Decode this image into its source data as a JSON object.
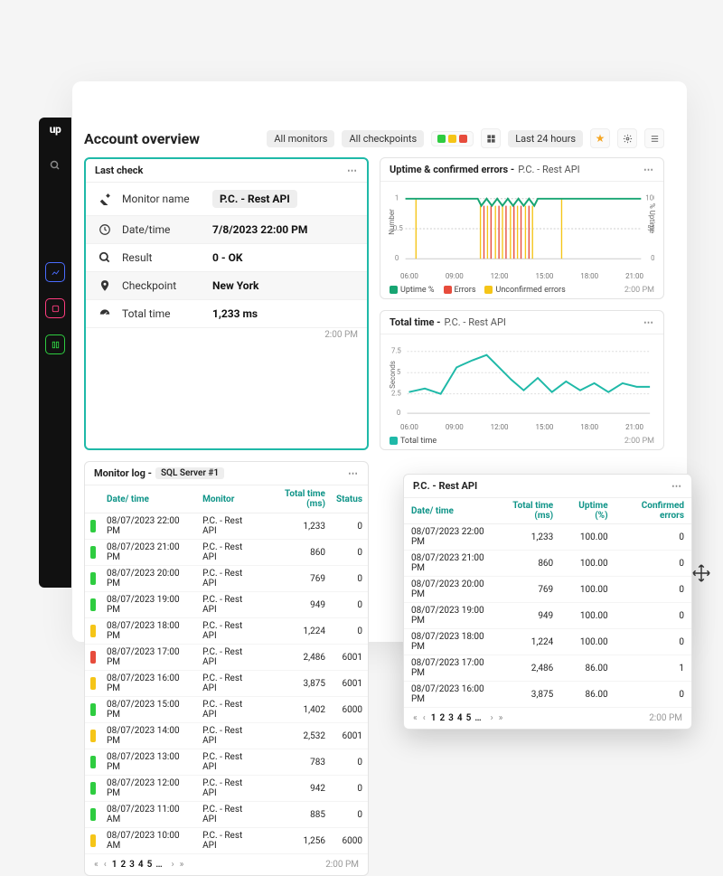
{
  "header": {
    "title": "Account overview",
    "filter_monitors": "All monitors",
    "filter_checkpoints": "All checkpoints",
    "timerange": "Last 24 hours"
  },
  "sidebar": {
    "logo": "up"
  },
  "last_check": {
    "title": "Last check",
    "rows": [
      {
        "label": "Monitor name",
        "value": "P.C. - Rest API",
        "chip": true
      },
      {
        "label": "Date/time",
        "value": "7/8/2023 22:00 PM"
      },
      {
        "label": "Result",
        "value": "0 - OK"
      },
      {
        "label": "Checkpoint",
        "value": "New York"
      },
      {
        "label": "Total time",
        "value": "1,233 ms"
      }
    ],
    "timestamp": "2:00 PM"
  },
  "uptime_card": {
    "title": "Uptime & confirmed errors -",
    "subtitle": "P.C. - Rest API",
    "left_axis": "Number",
    "right_axis": "% Uptime",
    "legend": {
      "uptime": "Uptime %",
      "errors": "Errors",
      "unconfirmed": "Unconfirmed errors"
    },
    "timestamp": "2:00 PM",
    "xticks": [
      "06:00",
      "09:00",
      "12:00",
      "15:00",
      "18:00",
      "21:00"
    ],
    "yticks_left": [
      "1",
      "0.5",
      "0"
    ],
    "yticks_right": [
      "100",
      "50",
      "0"
    ]
  },
  "totaltime_card": {
    "title": "Total time -",
    "subtitle": "P.C. - Rest API",
    "left_axis": "Seconds",
    "legend": {
      "total": "Total time"
    },
    "timestamp": "2:00 PM",
    "xticks": [
      "06:00",
      "09:00",
      "12:00",
      "15:00",
      "18:00",
      "21:00"
    ],
    "yticks": [
      "7.5",
      "5",
      "2.5",
      "0"
    ]
  },
  "monitor_log": {
    "title": "Monitor log -",
    "chip": "SQL Server #1",
    "columns": {
      "dt": "Date/ time",
      "mon": "Monitor",
      "tt": "Total time (ms)",
      "st": "Status"
    },
    "rows": [
      {
        "s": "ok",
        "dt": "08/07/2023 22:00 PM",
        "mon": "P.C. - Rest API",
        "tt": "1,233",
        "st": "0"
      },
      {
        "s": "ok",
        "dt": "08/07/2023 21:00 PM",
        "mon": "P.C. - Rest API",
        "tt": "860",
        "st": "0"
      },
      {
        "s": "ok",
        "dt": "08/07/2023 20:00 PM",
        "mon": "P.C. - Rest API",
        "tt": "769",
        "st": "0"
      },
      {
        "s": "ok",
        "dt": "08/07/2023 19:00 PM",
        "mon": "P.C. - Rest API",
        "tt": "949",
        "st": "0"
      },
      {
        "s": "warn",
        "dt": "08/07/2023 18:00 PM",
        "mon": "P.C. - Rest API",
        "tt": "1,224",
        "st": "0"
      },
      {
        "s": "err",
        "dt": "08/07/2023 17:00 PM",
        "mon": "P.C. - Rest API",
        "tt": "2,486",
        "st": "6001"
      },
      {
        "s": "warn",
        "dt": "08/07/2023 16:00 PM",
        "mon": "P.C. - Rest API",
        "tt": "3,875",
        "st": "6001"
      },
      {
        "s": "ok",
        "dt": "08/07/2023 15:00 PM",
        "mon": "P.C. - Rest API",
        "tt": "1,402",
        "st": "6000"
      },
      {
        "s": "warn",
        "dt": "08/07/2023 14:00 PM",
        "mon": "P.C. - Rest API",
        "tt": "2,532",
        "st": "6001"
      },
      {
        "s": "ok",
        "dt": "08/07/2023 13:00 PM",
        "mon": "P.C. - Rest API",
        "tt": "783",
        "st": "0"
      },
      {
        "s": "ok",
        "dt": "08/07/2023 12:00 PM",
        "mon": "P.C. - Rest API",
        "tt": "942",
        "st": "0"
      },
      {
        "s": "ok",
        "dt": "08/07/2023 11:00 AM",
        "mon": "P.C. - Rest API",
        "tt": "885",
        "st": "0"
      },
      {
        "s": "warn",
        "dt": "08/07/2023 10:00 AM",
        "mon": "P.C. - Rest API",
        "tt": "1,256",
        "st": "6000"
      }
    ],
    "pager": {
      "pages": [
        "1",
        "2",
        "3",
        "4",
        "5",
        "…"
      ],
      "timestamp": "2:00 PM"
    }
  },
  "popup": {
    "title": "P.C. - Rest API",
    "columns": {
      "dt": "Date/ time",
      "tt": "Total time (ms)",
      "up": "Uptime (%)",
      "ce": "Confirmed errors"
    },
    "rows": [
      {
        "dt": "08/07/2023 22:00 PM",
        "tt": "1,233",
        "up": "100.00",
        "ce": "0"
      },
      {
        "dt": "08/07/2023 21:00 PM",
        "tt": "860",
        "up": "100.00",
        "ce": "0"
      },
      {
        "dt": "08/07/2023 20:00 PM",
        "tt": "769",
        "up": "100.00",
        "ce": "0"
      },
      {
        "dt": "08/07/2023 19:00 PM",
        "tt": "949",
        "up": "100.00",
        "ce": "0"
      },
      {
        "dt": "08/07/2023 18:00 PM",
        "tt": "1,224",
        "up": "100.00",
        "ce": "0"
      },
      {
        "dt": "08/07/2023 17:00 PM",
        "tt": "2,486",
        "up": "86.00",
        "ce": "1"
      },
      {
        "dt": "08/07/2023 16:00 PM",
        "tt": "3,875",
        "up": "86.00",
        "ce": "0"
      }
    ],
    "pager": {
      "pages": [
        "1",
        "2",
        "3",
        "4",
        "5",
        "…"
      ],
      "timestamp": "2:00 PM"
    }
  },
  "chart_data": [
    {
      "type": "line",
      "title": "Uptime & confirmed errors - P.C. - Rest API",
      "x": [
        "06:00",
        "07:00",
        "08:00",
        "09:00",
        "10:00",
        "11:00",
        "12:00",
        "13:00",
        "14:00",
        "15:00",
        "16:00",
        "17:00",
        "18:00",
        "21:00"
      ],
      "series": [
        {
          "name": "Uptime %",
          "values": [
            100,
            100,
            100,
            100,
            86,
            86,
            86,
            86,
            86,
            86,
            86,
            100,
            100,
            100
          ],
          "axis": "right"
        },
        {
          "name": "Errors",
          "values": [
            0,
            0,
            0,
            0,
            1,
            1,
            1,
            1,
            1,
            1,
            1,
            0,
            0,
            0
          ],
          "axis": "left"
        },
        {
          "name": "Unconfirmed errors",
          "values": [
            0,
            0,
            0,
            0,
            1,
            0,
            1,
            0,
            1,
            0,
            1,
            0,
            0,
            0
          ],
          "axis": "left"
        }
      ],
      "ylabel_left": "Number",
      "ylabel_right": "% Uptime",
      "ylim_left": [
        0,
        1
      ],
      "ylim_right": [
        0,
        100
      ]
    },
    {
      "type": "line",
      "title": "Total time - P.C. - Rest API",
      "x": [
        "06:00",
        "07:00",
        "08:00",
        "09:00",
        "10:00",
        "11:00",
        "12:00",
        "13:00",
        "14:00",
        "15:00",
        "16:00",
        "17:00",
        "18:00",
        "19:00",
        "20:00",
        "21:00",
        "22:00"
      ],
      "series": [
        {
          "name": "Total time",
          "values": [
            3.2,
            3.5,
            3.0,
            5.8,
            6.5,
            7.0,
            5.8,
            4.5,
            3.5,
            4.6,
            3.3,
            4.2,
            3.4,
            4.0,
            3.3,
            4.0,
            3.7
          ]
        }
      ],
      "ylabel": "Seconds",
      "ylim": [
        0,
        7.5
      ]
    }
  ]
}
